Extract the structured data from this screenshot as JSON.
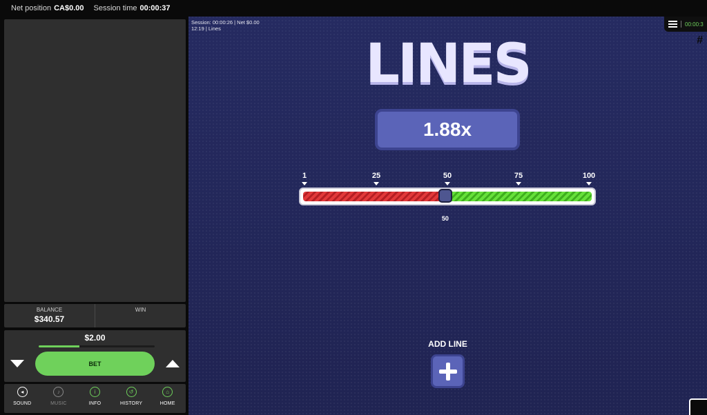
{
  "topbar": {
    "net_position_label": "Net position",
    "net_position_value": "CA$0.00",
    "session_time_label": "Session time",
    "session_time_value": "00:00:37"
  },
  "stats": {
    "balance_label": "BALANCE",
    "balance_value": "$340.57",
    "win_label": "WIN",
    "win_value": ""
  },
  "bet": {
    "amount": "$2.00",
    "button_label": "BET",
    "progress_fraction": 0.35
  },
  "nav": {
    "items": [
      {
        "label": "SOUND",
        "icon": "speaker-muted-icon",
        "glyph": "◂"
      },
      {
        "label": "MUSIC",
        "icon": "music-note-icon",
        "glyph": "♪"
      },
      {
        "label": "INFO",
        "icon": "info-icon",
        "glyph": "i"
      },
      {
        "label": "HISTORY",
        "icon": "history-icon",
        "glyph": "↺"
      },
      {
        "label": "HOME",
        "icon": "home-icon",
        "glyph": "⌂"
      }
    ]
  },
  "game": {
    "session_line1": "Session: 00:00:26 | Net  $0.00",
    "session_line2": "12:19 | Lines",
    "clock": "00:00:3",
    "hash_glyph": "#",
    "title": "LINES",
    "multiplier": "1.88x",
    "scale": [
      "1",
      "25",
      "50",
      "75",
      "100"
    ],
    "slider_value": 50,
    "slider_label": "50",
    "add_line_label": "ADD LINE"
  },
  "colors": {
    "accent_green": "#6fd15b",
    "game_bg": "#24285a",
    "panel": "#2f2f2f",
    "multiplier_box": "#5b64b8"
  }
}
